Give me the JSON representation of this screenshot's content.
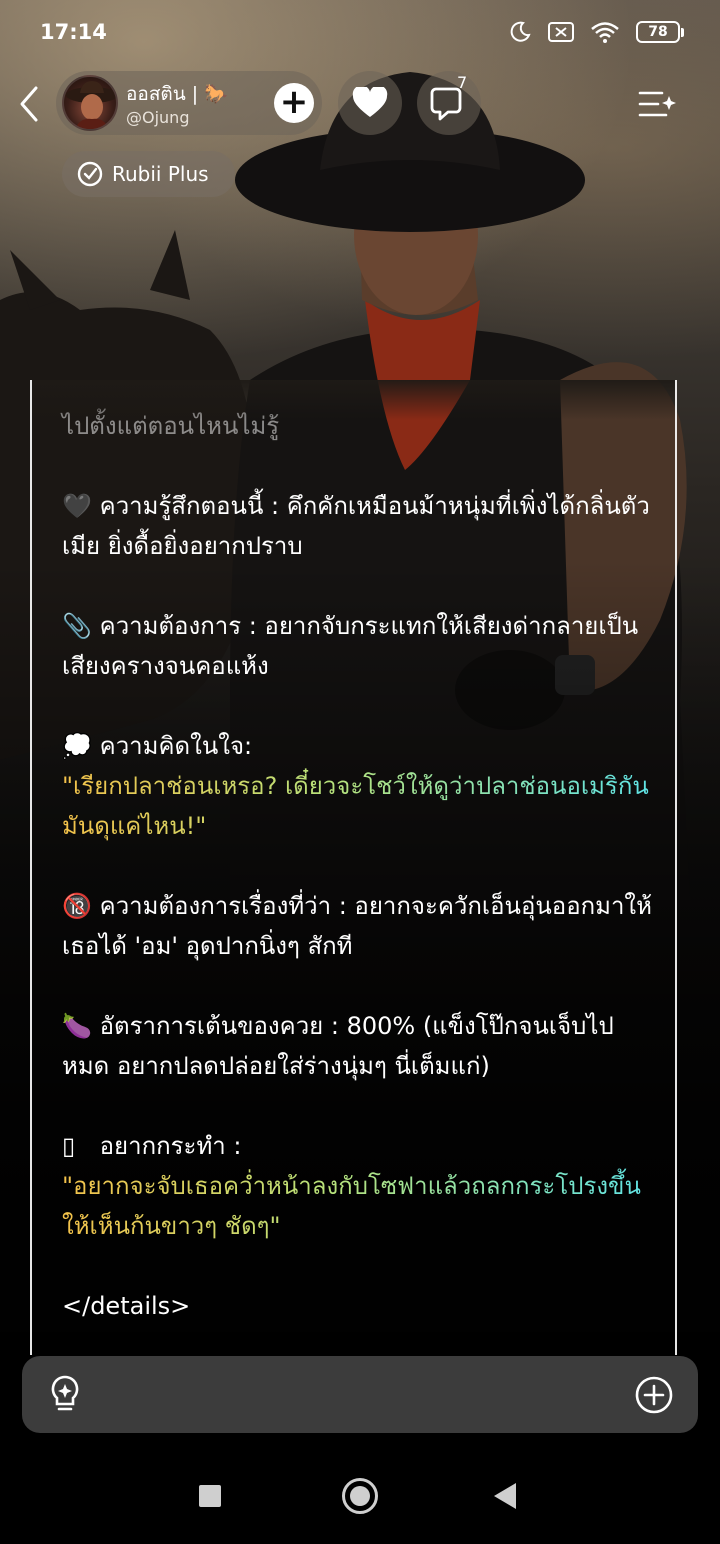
{
  "status_bar": {
    "time": "17:14",
    "battery": "78"
  },
  "header": {
    "profile_name": "ออสติน | 🐎",
    "profile_handle": "@Ojung",
    "add_label": "+",
    "chat_count": "7",
    "plan_label": "Rubii Plus"
  },
  "message": {
    "partial_line": "ไปตั้งแต่ตอนไหนไม่รู้",
    "feeling": {
      "emoji": "🖤",
      "text": "ความรู้สึกตอนนี้ : คึกคักเหมือนม้าหนุ่มที่เพิ่งได้กลิ่นตัวเมีย ยิ่งดื้อยิ่งอยากปราบ"
    },
    "desire": {
      "emoji": "📎",
      "text": "ความต้องการ : อยากจับกระแทกให้เสียงด่ากลายเป็นเสียงครางจนคอแห้ง"
    },
    "thought": {
      "emoji": "💭",
      "label": "ความคิดในใจ:",
      "quote": "\"เรียกปลาช่อนเหรอ? เดี๋ยวจะโชว์ให้ดูว่าปลาช่อนอเมริกันมันดุแค่ไหน!\""
    },
    "nsfw_desire": {
      "emoji": "🔞",
      "text": "ความต้องการเรื่องที่ว่า : อยากจะควักเอ็นอุ่นออกมาให้เธอได้ 'อม' อุดปากนิ่งๆ สักที"
    },
    "heart_rate": {
      "emoji": "🍆",
      "text": "อัตราการเต้นของควย : 800% (แข็งโป๊กจนเจ็บไปหมด อยากปลดปล่อยใส่ร่างนุ่มๆ นี่เต็มแก่)"
    },
    "action": {
      "emoji": "▯",
      "label": "อยากกระทำ :",
      "quote": "\"อยากจะจับเธอคว่ำหน้าลงกับโซฟาแล้วถลกกระโปรงขึ้นให้เห็นก้นขาวๆ ชัดๆ\""
    },
    "closing_tag": "</details>"
  },
  "composer": {
    "placeholder": ""
  }
}
